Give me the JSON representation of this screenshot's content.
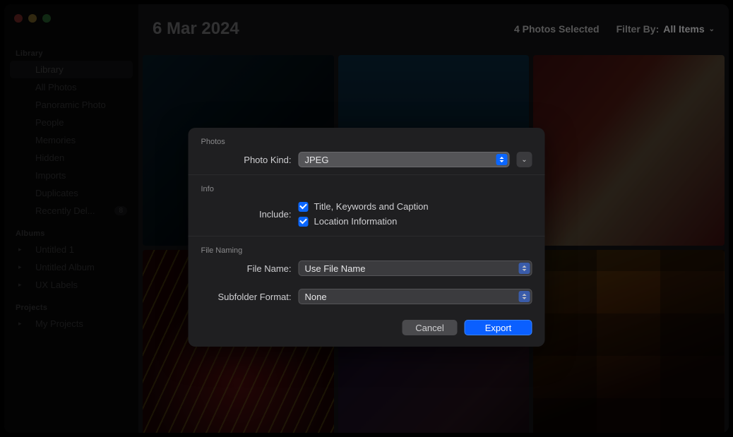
{
  "sidebar": {
    "sections": [
      {
        "label": "Library",
        "items": [
          {
            "label": "Library",
            "active": true
          },
          {
            "label": "All Photos"
          },
          {
            "label": "Panoramic Photo"
          },
          {
            "label": "People"
          },
          {
            "label": "Memories"
          },
          {
            "label": "Hidden"
          },
          {
            "label": "Imports"
          },
          {
            "label": "Duplicates"
          },
          {
            "label": "Recently Del...",
            "badge": "8"
          }
        ]
      },
      {
        "label": "Albums",
        "items": [
          {
            "label": "Untitled 1",
            "chev": true
          },
          {
            "label": "Untitled Album",
            "chev": true
          },
          {
            "label": "UX Labels",
            "chev": true
          }
        ]
      },
      {
        "label": "Projects",
        "items": [
          {
            "label": "My Projects",
            "chev": true
          }
        ]
      }
    ]
  },
  "topbar": {
    "date": "6 Mar 2024",
    "selected_text": "4 Photos Selected",
    "filter_label": "Filter By:",
    "filter_value": "All Items"
  },
  "sheet": {
    "section_photos": "Photos",
    "photo_kind_label": "Photo Kind:",
    "photo_kind_value": "JPEG",
    "section_info": "Info",
    "include_label": "Include:",
    "include_title": "Title, Keywords and Caption",
    "include_location": "Location Information",
    "section_naming": "File Naming",
    "file_name_label": "File Name:",
    "file_name_value": "Use File Name",
    "subfolder_label": "Subfolder Format:",
    "subfolder_value": "None",
    "cancel": "Cancel",
    "export": "Export"
  }
}
